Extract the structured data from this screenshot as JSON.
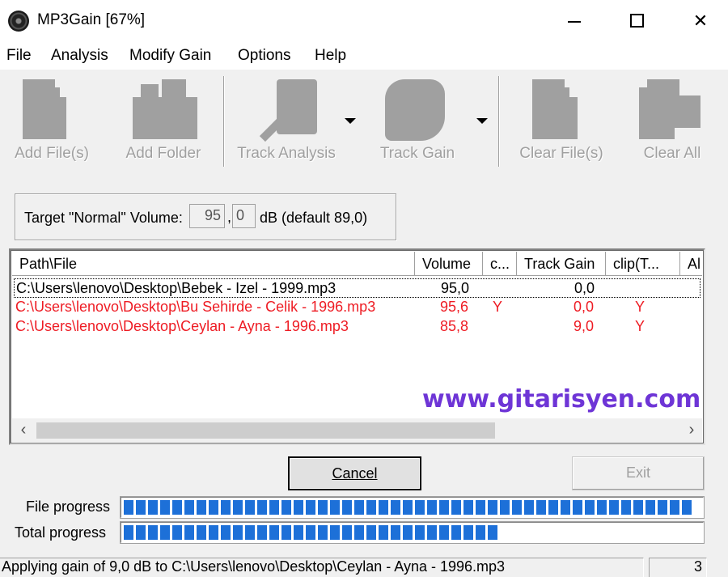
{
  "window": {
    "title": "MP3Gain [67%]"
  },
  "menu": [
    "File",
    "Analysis",
    "Modify Gain",
    "Options",
    "Help"
  ],
  "toolbar": {
    "add_files": "Add File(s)",
    "add_folder": "Add Folder",
    "track_analysis": "Track Analysis",
    "track_gain": "Track Gain",
    "clear_files": "Clear File(s)",
    "clear_all": "Clear All"
  },
  "target": {
    "label": "Target \"Normal\" Volume:",
    "int_value": "95",
    "comma": ",",
    "dec_value": "0",
    "unit_text": "dB  (default 89,0)"
  },
  "columns": [
    "Path\\File",
    "Volume",
    "c...",
    "Track Gain",
    "clip(T...",
    "Al"
  ],
  "files": [
    {
      "path": "C:\\Users\\lenovo\\Desktop\\Bebek - Izel - 1999.mp3",
      "volume": "95,0",
      "clip": "",
      "track_gain": "0,0",
      "clip_t": "",
      "color": "#000000"
    },
    {
      "path": "C:\\Users\\lenovo\\Desktop\\Bu Sehirde - Celik - 1996.mp3",
      "volume": "95,6",
      "clip": "Y",
      "track_gain": "0,0",
      "clip_t": "Y",
      "color": "#ee1c24"
    },
    {
      "path": "C:\\Users\\lenovo\\Desktop\\Ceylan - Ayna - 1996.mp3",
      "volume": "85,8",
      "clip": "",
      "track_gain": "9,0",
      "clip_t": "Y",
      "color": "#ee1c24"
    }
  ],
  "watermark": "www.gitarisyen.com",
  "buttons": {
    "cancel": "Cancel",
    "exit": "Exit"
  },
  "progress": {
    "file_label": "File progress",
    "file_value": 0.98,
    "total_label": "Total progress",
    "total_value": 0.66
  },
  "status": {
    "message": "Applying gain of 9,0 dB to C:\\Users\\lenovo\\Desktop\\Ceylan - Ayna - 1996.mp3",
    "count": "3"
  },
  "colors": {
    "progress": "#1d70d8",
    "clipping": "#ee1c24",
    "watermark": "#6e35d6"
  }
}
